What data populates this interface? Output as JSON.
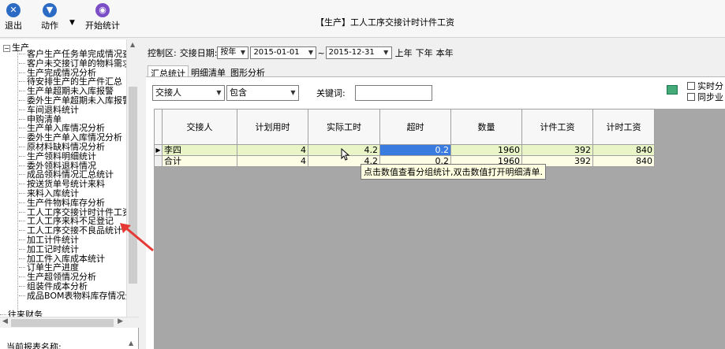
{
  "toolbar": {
    "exit_label": "退出",
    "action_label": "动作",
    "start_label": "开始统计",
    "dropdown_glyph": "▼"
  },
  "window_title": "【生产】工人工序交接计时计件工资",
  "tree": {
    "root_label": "生产",
    "items": [
      "客户生产任务单完成情况查",
      "客户未交接订单的物料需求",
      "生产完成情况分析",
      "待安排生产的生产件汇总",
      "生产单超期未入库报警",
      "委外生产单超期未入库报警",
      "车间退料统计",
      "申购清单",
      "生产单入库情况分析",
      "委外生产单入库情况分析",
      "原材料缺料情况分析",
      "生产领料明细统计",
      "委外领料退料情况",
      "成品领料情况汇总统计",
      "按送货单号统计来料",
      "来料入库统计",
      "生产件物料库存分析",
      "工人工序交接计时计件工资",
      "工人工序来料不足登记",
      "工人工序交接不良品统计",
      "加工计件统计",
      "加工记时统计",
      "加工件入库成本统计",
      "订单生产进度",
      "生产超领情况分析",
      "组装件成本分析",
      "成品BOM表物料库存情况分"
    ],
    "bottom_item": "往来财务",
    "report_name_label": "当前报表名称:"
  },
  "control": {
    "area_label": "控制区:",
    "date_label": "交接日期:",
    "range_mode": "按年",
    "date_from": "2015-01-01",
    "tilde": "~",
    "date_to": "2015-12-31",
    "prev_year": "上年",
    "next_year": "下年",
    "this_year": "本年"
  },
  "tabs": [
    "汇总统计",
    "明细清单",
    "图形分析"
  ],
  "filter": {
    "field": "交接人",
    "operator": "包含",
    "keyword_label": "关键词:",
    "keyword_value": ""
  },
  "options": {
    "realtime_label": "实时分",
    "sync_label": "同步业"
  },
  "grid": {
    "headers": [
      "交接人",
      "计划用时",
      "实际工时",
      "超时",
      "数量",
      "计件工资",
      "计时工资"
    ],
    "rows": [
      {
        "indicator": "▶",
        "cells": [
          "李四",
          "4",
          "4.2",
          "0.2",
          "1960",
          "392",
          "840"
        ]
      },
      {
        "indicator": "",
        "cells": [
          "合计",
          "4",
          "4.2",
          "0.2",
          "1960",
          "392",
          "840"
        ]
      }
    ]
  },
  "tooltip": "点击数值查看分组统计,双击数值打开明细清单.",
  "colors": {
    "selected_cell": "#3a7be0",
    "row_highlight": "#e9f5c6",
    "total_row": "#fdfde6",
    "annotation_arrow": "#e53935"
  }
}
